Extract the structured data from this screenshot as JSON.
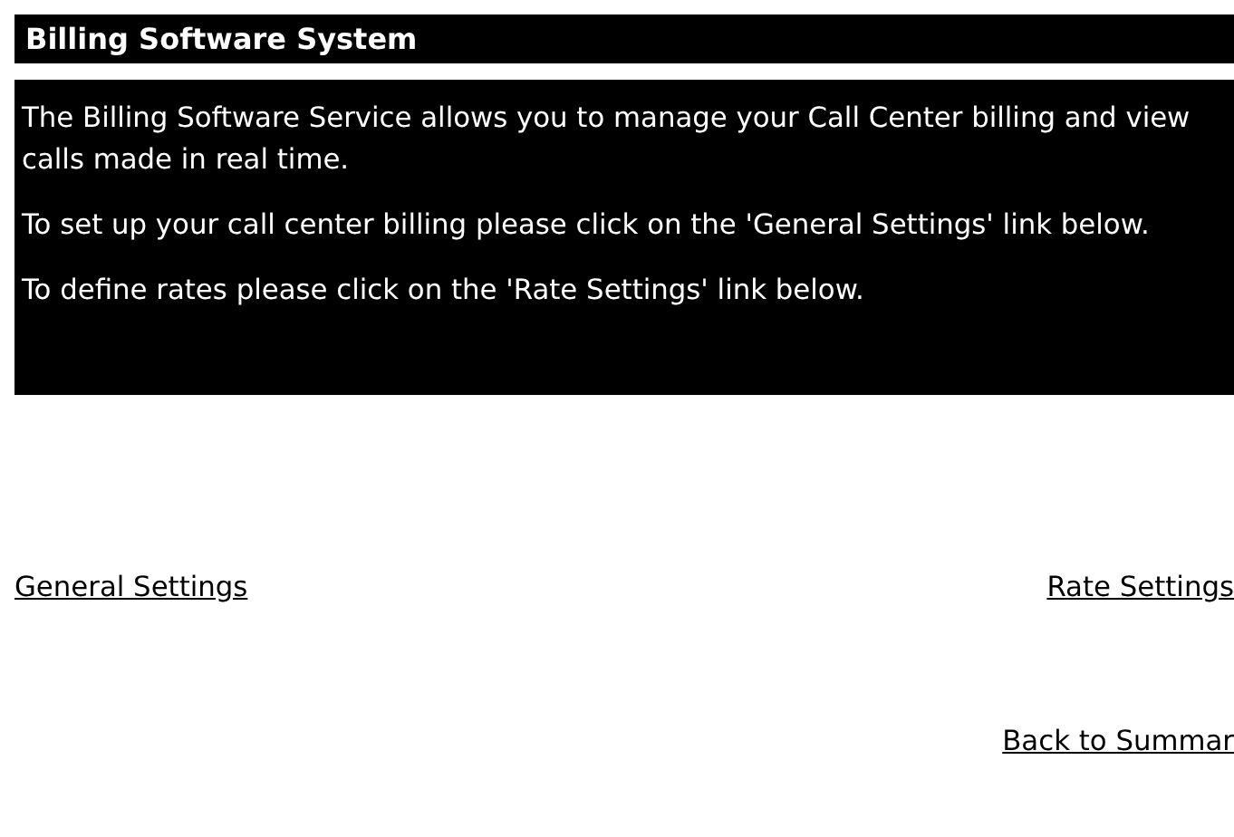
{
  "header": {
    "title": "Billing Software System"
  },
  "info_panel": {
    "paragraphs": [
      "The Billing Software Service allows you to manage your Call Center billing and view calls made in real time.",
      "To set up your call center billing please click on the 'General Settings' link below.",
      "To define rates please click on the 'Rate Settings' link below."
    ]
  },
  "links": [
    {
      "label": "General Settings"
    },
    {
      "label": "Rate Settings"
    }
  ],
  "footer_link": {
    "label": "Back to Summar"
  }
}
